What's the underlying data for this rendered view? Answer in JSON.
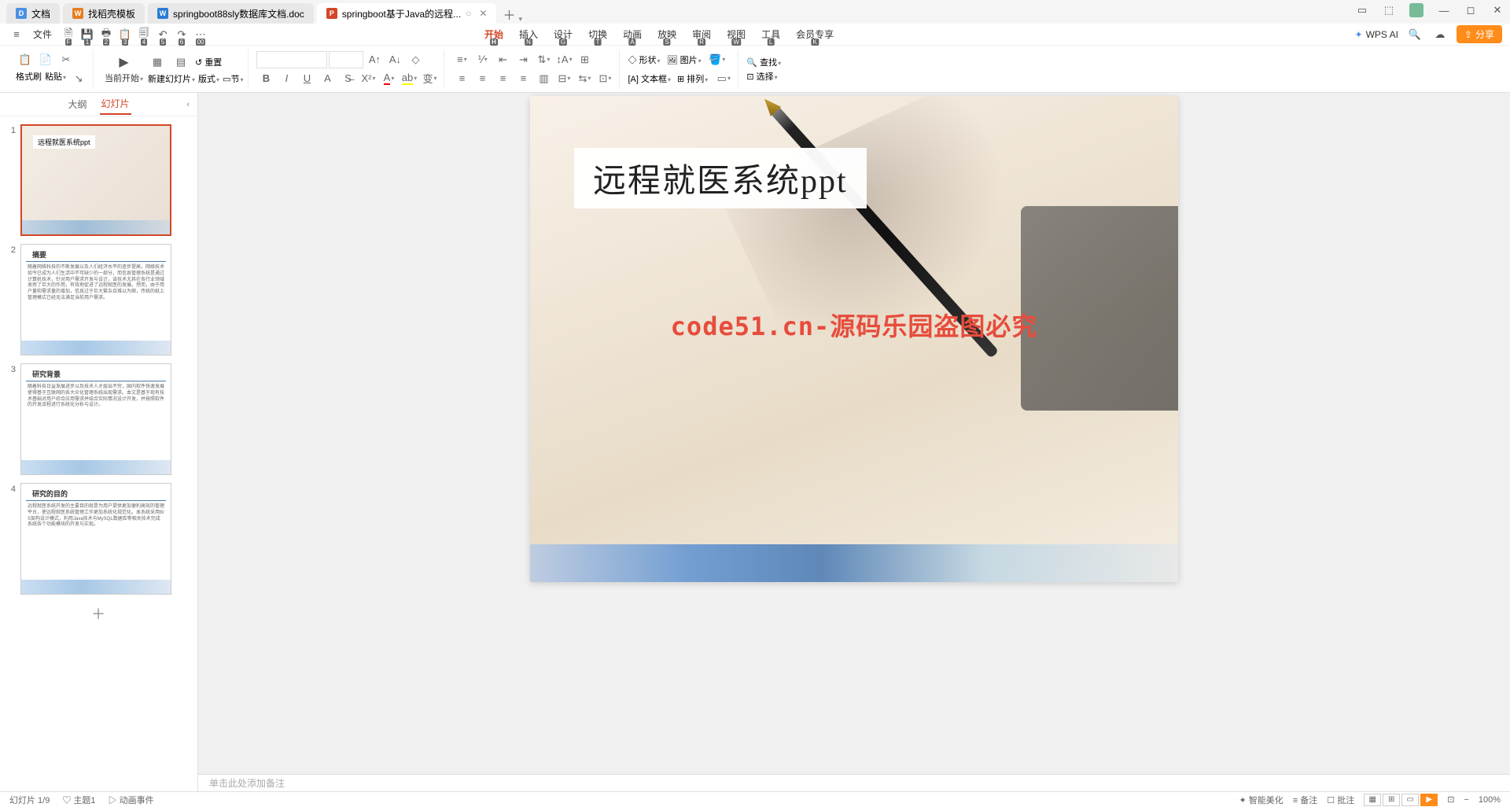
{
  "tabs": [
    {
      "icon": "D",
      "iconClass": "blue",
      "label": "文档"
    },
    {
      "icon": "W",
      "iconClass": "orange",
      "label": "找稻壳模板"
    },
    {
      "icon": "W",
      "iconClass": "wdoc",
      "label": "springboot88sly数据库文档.doc"
    },
    {
      "icon": "P",
      "iconClass": "pdoc",
      "label": "springboot基于Java的远程...",
      "active": true,
      "closable": true
    }
  ],
  "windowControls": [
    "☐",
    "⬚",
    "▭",
    "—",
    "◻",
    "✕"
  ],
  "qaBar": {
    "docLabel": "文件",
    "quickBtns": [
      {
        "ico": "🗎",
        "sub": "F"
      },
      {
        "ico": "💾",
        "sub": "1"
      },
      {
        "ico": "🖶",
        "sub": "2"
      },
      {
        "ico": "📋",
        "sub": "3"
      },
      {
        "ico": "🗐",
        "sub": "4"
      },
      {
        "ico": "↶",
        "sub": "5"
      },
      {
        "ico": "↷",
        "sub": "6"
      },
      {
        "ico": "⋯",
        "sub": "00"
      }
    ]
  },
  "menuTabs": [
    {
      "label": "开始",
      "sub": "H",
      "active": true
    },
    {
      "label": "插入",
      "sub": "N"
    },
    {
      "label": "设计",
      "sub": "G"
    },
    {
      "label": "切换",
      "sub": "T"
    },
    {
      "label": "动画",
      "sub": "A"
    },
    {
      "label": "放映",
      "sub": "S"
    },
    {
      "label": "审阅",
      "sub": "R"
    },
    {
      "label": "视图",
      "sub": "W"
    },
    {
      "label": "工具",
      "sub": "L"
    },
    {
      "label": "会员专享",
      "sub": "K"
    }
  ],
  "wpsAi": "WPS AI",
  "shareLabel": "分享",
  "ribbon": {
    "formatPainter": "格式刷",
    "paste": "粘贴",
    "currentStart": "当前开始",
    "newSlide": "新建幻灯片",
    "layout": "版式",
    "section": "节",
    "reset": "重置",
    "shape": "形状",
    "image": "图片",
    "textbox": "文本框",
    "arrange": "排列",
    "find": "查找",
    "select": "选择"
  },
  "sideTabs": {
    "outline": "大纲",
    "slides": "幻灯片"
  },
  "thumbnails": [
    {
      "num": "1",
      "title": "远程就医系统ppt",
      "type": "title",
      "active": true
    },
    {
      "num": "2",
      "heading": "摘要",
      "body": "随着网络科技的不断发展以及人们经济水平的逐步提高，网络技术如今已成为人们生活中不可缺少的一部分，而信息管理系统是通过计算机技术，针对用户需求开发与设计，该技术尤其在各行业领域发挥了巨大的作用，有效地促进了远程就医的发展。然而，由于用户量和需求量的增加，信息过于巨大繁杂且难以为继，传统的纸上管理模式已经无法满足当前用户需求。",
      "type": "content"
    },
    {
      "num": "3",
      "heading": "研究背景",
      "body": "随着科技日益发展进步以及技术人才层出不穷，国内软件快速发展使得基于互联网的各大众化管理系统出现需求。本文是基于现有技术基础对用户综合应用需求并结合实际情况设计开发，并按照软件的开发流程进行系统化分析与设计。",
      "type": "content"
    },
    {
      "num": "4",
      "heading": "研究的目的",
      "body": "远程就医系统开发的主要目的就是为用户提供更加便利高效的管理平台，使远程就医系统管理工作更加系统化规范化。本系统采用B/S架构设计模式，利用Java技术与MySQL数据库等相关技术完成系统各个功能模块的开发与实现。",
      "type": "content"
    }
  ],
  "slide": {
    "title": "远程就医系统ppt",
    "watermark": "code51.cn-源码乐园盗图必究"
  },
  "notesPlaceholder": "单击此处添加备注",
  "statusBar": {
    "left": [
      "幻灯片 1/9",
      "♡ 主题1",
      "▷ 动画事件"
    ],
    "right": [
      "✦ 智能美化",
      "≡ 备注",
      "☐ 批注",
      "100%"
    ]
  }
}
